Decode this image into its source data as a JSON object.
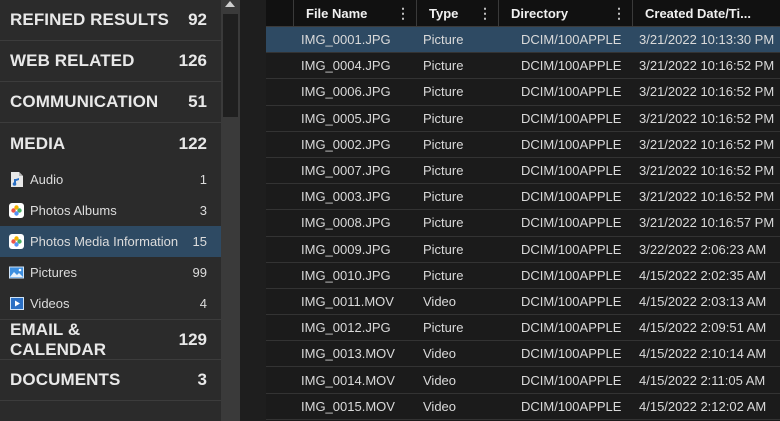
{
  "sidebar": {
    "categories_top": [
      {
        "label": "REFINED RESULTS",
        "count": "92"
      },
      {
        "label": "WEB RELATED",
        "count": "126"
      },
      {
        "label": "COMMUNICATION",
        "count": "51"
      }
    ],
    "media": {
      "label": "MEDIA",
      "count": "122",
      "items": [
        {
          "label": "Audio",
          "count": "1",
          "icon": "audio-file-icon"
        },
        {
          "label": "Photos Albums",
          "count": "3",
          "icon": "photos-app-icon"
        },
        {
          "label": "Photos Media Information",
          "count": "15",
          "icon": "photos-app-icon",
          "selected": true
        },
        {
          "label": "Pictures",
          "count": "99",
          "icon": "picture-icon"
        },
        {
          "label": "Videos",
          "count": "4",
          "icon": "video-play-icon"
        }
      ]
    },
    "categories_bottom": [
      {
        "label": "EMAIL & CALENDAR",
        "count": "129"
      },
      {
        "label": "DOCUMENTS",
        "count": "3"
      }
    ]
  },
  "table": {
    "columns": [
      "File Name",
      "Type",
      "Directory",
      "Created Date/Ti..."
    ],
    "rows": [
      [
        "IMG_0001.JPG",
        "Picture",
        "DCIM/100APPLE",
        "3/21/2022 10:13:30 PM"
      ],
      [
        "IMG_0004.JPG",
        "Picture",
        "DCIM/100APPLE",
        "3/21/2022 10:16:52 PM"
      ],
      [
        "IMG_0006.JPG",
        "Picture",
        "DCIM/100APPLE",
        "3/21/2022 10:16:52 PM"
      ],
      [
        "IMG_0005.JPG",
        "Picture",
        "DCIM/100APPLE",
        "3/21/2022 10:16:52 PM"
      ],
      [
        "IMG_0002.JPG",
        "Picture",
        "DCIM/100APPLE",
        "3/21/2022 10:16:52 PM"
      ],
      [
        "IMG_0007.JPG",
        "Picture",
        "DCIM/100APPLE",
        "3/21/2022 10:16:52 PM"
      ],
      [
        "IMG_0003.JPG",
        "Picture",
        "DCIM/100APPLE",
        "3/21/2022 10:16:52 PM"
      ],
      [
        "IMG_0008.JPG",
        "Picture",
        "DCIM/100APPLE",
        "3/21/2022 10:16:57 PM"
      ],
      [
        "IMG_0009.JPG",
        "Picture",
        "DCIM/100APPLE",
        "3/22/2022 2:06:23 AM"
      ],
      [
        "IMG_0010.JPG",
        "Picture",
        "DCIM/100APPLE",
        "4/15/2022 2:02:35 AM"
      ],
      [
        "IMG_0011.MOV",
        "Video",
        "DCIM/100APPLE",
        "4/15/2022 2:03:13 AM"
      ],
      [
        "IMG_0012.JPG",
        "Picture",
        "DCIM/100APPLE",
        "4/15/2022 2:09:51 AM"
      ],
      [
        "IMG_0013.MOV",
        "Video",
        "DCIM/100APPLE",
        "4/15/2022 2:10:14 AM"
      ],
      [
        "IMG_0014.MOV",
        "Video",
        "DCIM/100APPLE",
        "4/15/2022 2:11:05 AM"
      ],
      [
        "IMG_0015.MOV",
        "Video",
        "DCIM/100APPLE",
        "4/15/2022 2:12:02 AM"
      ]
    ],
    "selected_row": 0
  },
  "colors": {
    "selection": "#2e4a63",
    "sidebar_bg": "#2b2b2b",
    "table_bg": "#1b1b1b"
  }
}
